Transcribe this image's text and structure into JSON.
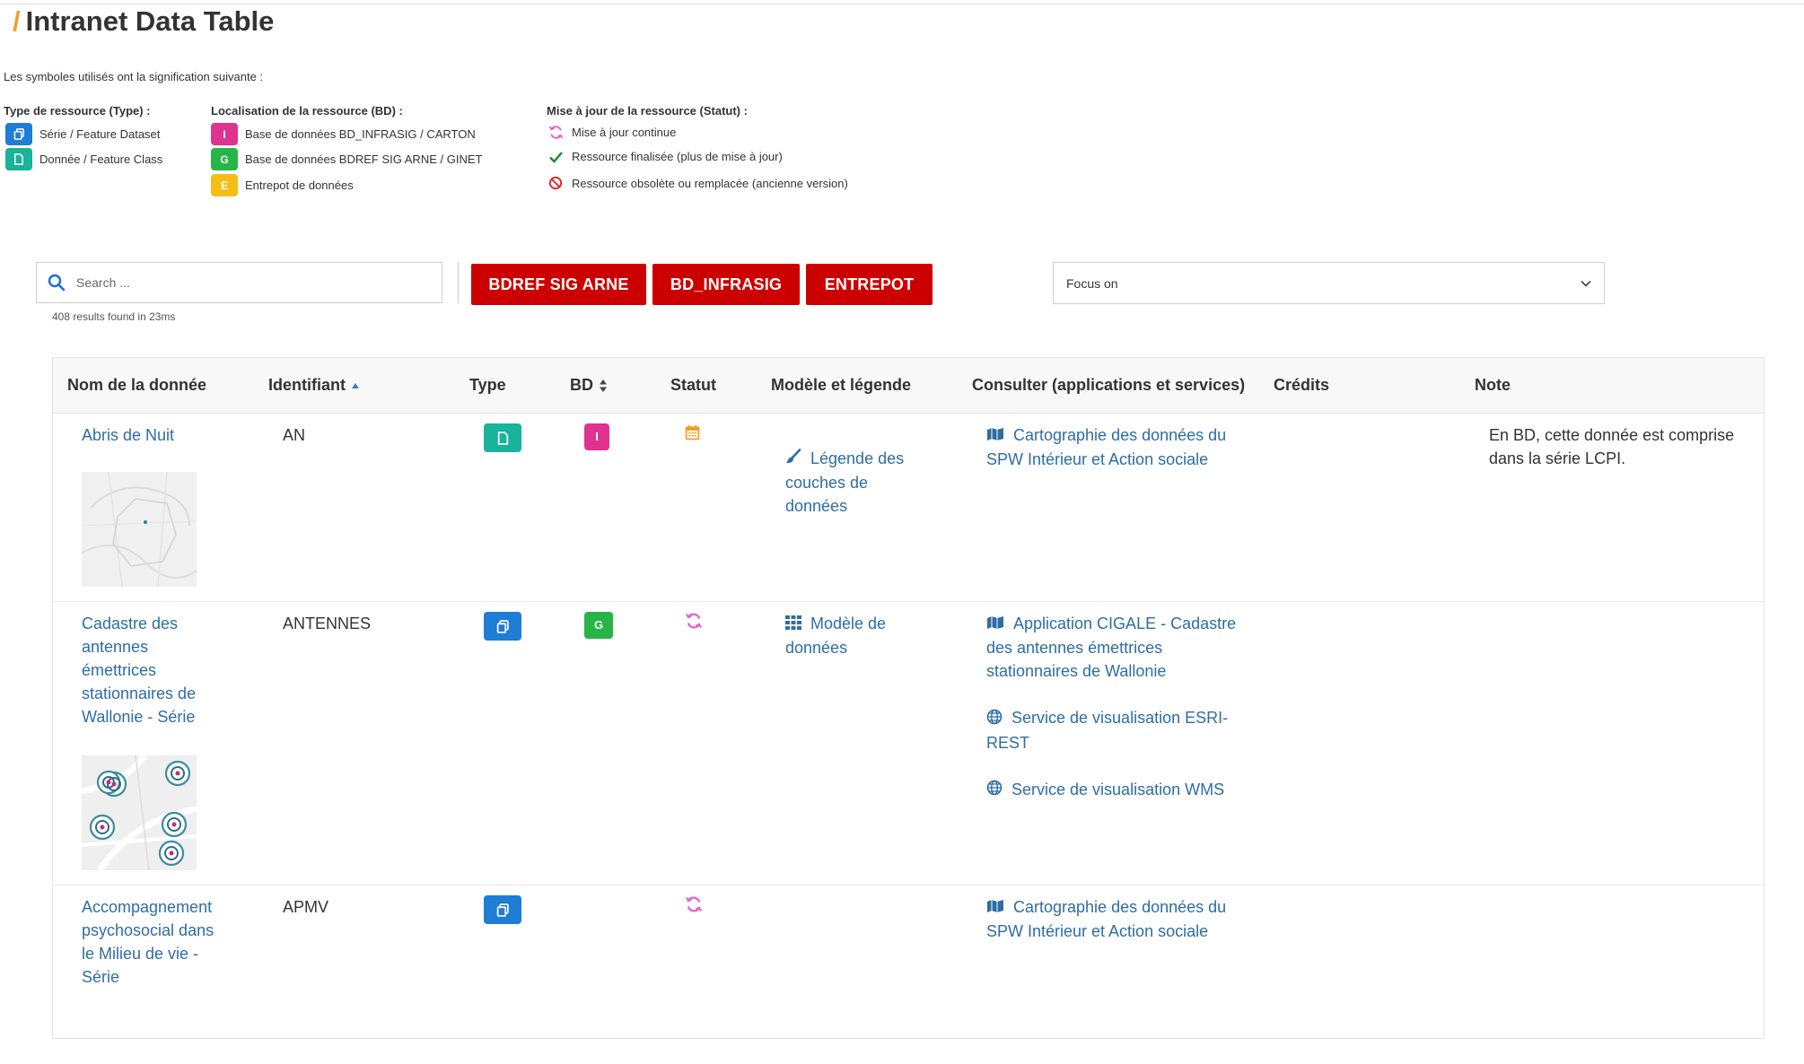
{
  "page": {
    "title": "Intranet Data Table"
  },
  "legend": {
    "intro": "Les symboles utilisés ont la signification suivante :",
    "type": {
      "heading": "Type de ressource (Type) :",
      "items": [
        {
          "label": "Série / Feature Dataset",
          "icon": "dataset-icon",
          "color": "#1e7dd4"
        },
        {
          "label": "Donnée / Feature Class",
          "icon": "feature-class-icon",
          "color": "#17b39a"
        }
      ]
    },
    "bd": {
      "heading": "Localisation de la ressource (BD) :",
      "items": [
        {
          "letter": "I",
          "label": "Base de données BD_INFRASIG / CARTON",
          "color": "#e0338f"
        },
        {
          "letter": "G",
          "label": "Base de données BDREF SIG ARNE / GINET",
          "color": "#28b446"
        },
        {
          "letter": "E",
          "label": "Entrepot de données",
          "color": "#f7bd17"
        }
      ]
    },
    "status": {
      "heading": "Mise à jour de la ressource (Statut) :",
      "items": [
        {
          "label": "Mise à jour continue",
          "icon": "sync-icon",
          "color": "#e860c8"
        },
        {
          "label": "Ressource finalisée (plus de mise à jour)",
          "icon": "check-icon",
          "color": "#1a8a2a"
        },
        {
          "label": "Ressource obsolète ou remplacée (ancienne version)",
          "icon": "ban-icon",
          "color": "#e02020"
        }
      ]
    }
  },
  "search": {
    "placeholder": "Search ...",
    "value": "",
    "result_count": "408 results found in 23ms"
  },
  "filters": [
    {
      "label": "BDREF SIG ARNE"
    },
    {
      "label": "BD_INFRASIG"
    },
    {
      "label": "ENTREPOT"
    }
  ],
  "focus": {
    "label": "Focus on"
  },
  "table": {
    "headers": [
      "Nom de la donnée",
      "Identifiant",
      "Type",
      "BD",
      "Statut",
      "Modèle et légende",
      "Consulter (applications et services)",
      "Crédits",
      "Note"
    ],
    "rows": [
      {
        "name": "Abris de Nuit",
        "id": "AN",
        "type": "feature-class",
        "bd": "I",
        "status": "calendar-icon",
        "model": [
          {
            "icon": "brush-icon",
            "text": "Légende des couches de données"
          }
        ],
        "services": [
          {
            "icon": "map-icon",
            "text": "Cartographie des données du SPW Intérieur et Action sociale"
          }
        ],
        "credits": "",
        "note": "En BD, cette donnée est comprise dans la série LCPI."
      },
      {
        "name": "Cadastre des antennes émettrices stationnaires de Wallonie - Série",
        "id": "ANTENNES",
        "type": "dataset",
        "bd": "G",
        "status": "sync-icon",
        "model": [
          {
            "icon": "grid-icon",
            "text": "Modèle de données"
          }
        ],
        "services": [
          {
            "icon": "map-icon",
            "text": "Application CIGALE - Cadastre des antennes émettrices stationnaires de Wallonie"
          },
          {
            "icon": "globe-icon",
            "text": "Service de visualisation ESRI-REST"
          },
          {
            "icon": "globe-icon",
            "text": "Service de visualisation WMS"
          }
        ],
        "credits": "",
        "note": ""
      },
      {
        "name": "Accompagnement psychosocial dans le Milieu de vie - Série",
        "id": "APMV",
        "type": "dataset",
        "bd": "",
        "status": "sync-icon",
        "model": [],
        "services": [
          {
            "icon": "map-icon",
            "text": "Cartographie des données du SPW Intérieur et Action sociale"
          }
        ],
        "credits": "",
        "note": ""
      }
    ]
  }
}
